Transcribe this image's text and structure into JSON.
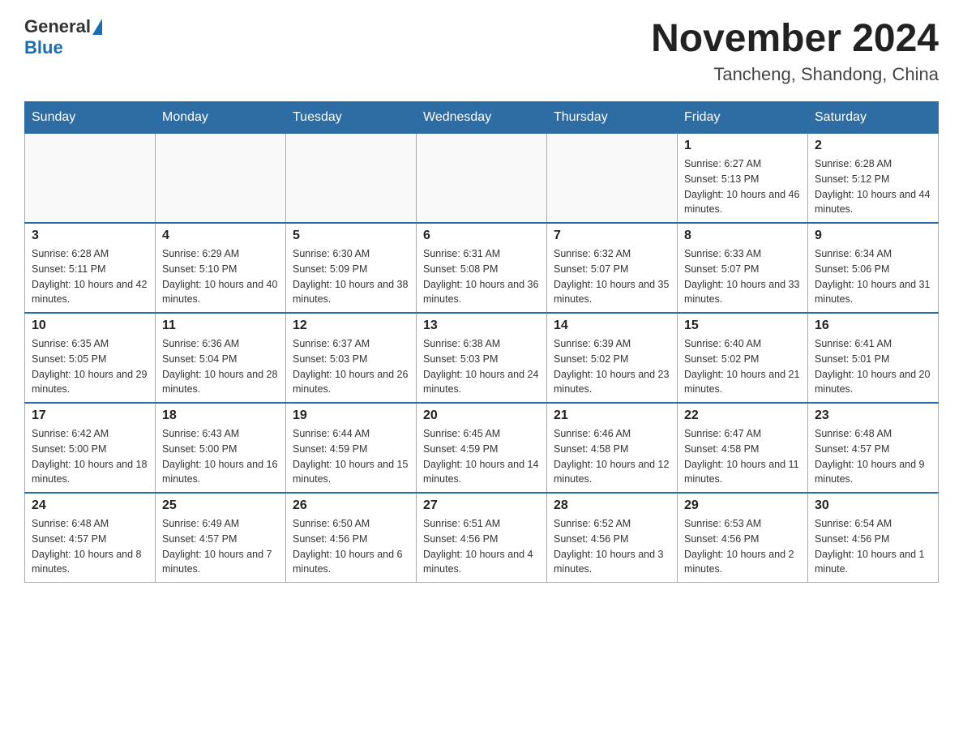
{
  "header": {
    "logo_general": "General",
    "logo_blue": "Blue",
    "month_title": "November 2024",
    "location": "Tancheng, Shandong, China"
  },
  "weekdays": [
    "Sunday",
    "Monday",
    "Tuesday",
    "Wednesday",
    "Thursday",
    "Friday",
    "Saturday"
  ],
  "weeks": [
    [
      {
        "day": "",
        "info": ""
      },
      {
        "day": "",
        "info": ""
      },
      {
        "day": "",
        "info": ""
      },
      {
        "day": "",
        "info": ""
      },
      {
        "day": "",
        "info": ""
      },
      {
        "day": "1",
        "info": "Sunrise: 6:27 AM\nSunset: 5:13 PM\nDaylight: 10 hours and 46 minutes."
      },
      {
        "day": "2",
        "info": "Sunrise: 6:28 AM\nSunset: 5:12 PM\nDaylight: 10 hours and 44 minutes."
      }
    ],
    [
      {
        "day": "3",
        "info": "Sunrise: 6:28 AM\nSunset: 5:11 PM\nDaylight: 10 hours and 42 minutes."
      },
      {
        "day": "4",
        "info": "Sunrise: 6:29 AM\nSunset: 5:10 PM\nDaylight: 10 hours and 40 minutes."
      },
      {
        "day": "5",
        "info": "Sunrise: 6:30 AM\nSunset: 5:09 PM\nDaylight: 10 hours and 38 minutes."
      },
      {
        "day": "6",
        "info": "Sunrise: 6:31 AM\nSunset: 5:08 PM\nDaylight: 10 hours and 36 minutes."
      },
      {
        "day": "7",
        "info": "Sunrise: 6:32 AM\nSunset: 5:07 PM\nDaylight: 10 hours and 35 minutes."
      },
      {
        "day": "8",
        "info": "Sunrise: 6:33 AM\nSunset: 5:07 PM\nDaylight: 10 hours and 33 minutes."
      },
      {
        "day": "9",
        "info": "Sunrise: 6:34 AM\nSunset: 5:06 PM\nDaylight: 10 hours and 31 minutes."
      }
    ],
    [
      {
        "day": "10",
        "info": "Sunrise: 6:35 AM\nSunset: 5:05 PM\nDaylight: 10 hours and 29 minutes."
      },
      {
        "day": "11",
        "info": "Sunrise: 6:36 AM\nSunset: 5:04 PM\nDaylight: 10 hours and 28 minutes."
      },
      {
        "day": "12",
        "info": "Sunrise: 6:37 AM\nSunset: 5:03 PM\nDaylight: 10 hours and 26 minutes."
      },
      {
        "day": "13",
        "info": "Sunrise: 6:38 AM\nSunset: 5:03 PM\nDaylight: 10 hours and 24 minutes."
      },
      {
        "day": "14",
        "info": "Sunrise: 6:39 AM\nSunset: 5:02 PM\nDaylight: 10 hours and 23 minutes."
      },
      {
        "day": "15",
        "info": "Sunrise: 6:40 AM\nSunset: 5:02 PM\nDaylight: 10 hours and 21 minutes."
      },
      {
        "day": "16",
        "info": "Sunrise: 6:41 AM\nSunset: 5:01 PM\nDaylight: 10 hours and 20 minutes."
      }
    ],
    [
      {
        "day": "17",
        "info": "Sunrise: 6:42 AM\nSunset: 5:00 PM\nDaylight: 10 hours and 18 minutes."
      },
      {
        "day": "18",
        "info": "Sunrise: 6:43 AM\nSunset: 5:00 PM\nDaylight: 10 hours and 16 minutes."
      },
      {
        "day": "19",
        "info": "Sunrise: 6:44 AM\nSunset: 4:59 PM\nDaylight: 10 hours and 15 minutes."
      },
      {
        "day": "20",
        "info": "Sunrise: 6:45 AM\nSunset: 4:59 PM\nDaylight: 10 hours and 14 minutes."
      },
      {
        "day": "21",
        "info": "Sunrise: 6:46 AM\nSunset: 4:58 PM\nDaylight: 10 hours and 12 minutes."
      },
      {
        "day": "22",
        "info": "Sunrise: 6:47 AM\nSunset: 4:58 PM\nDaylight: 10 hours and 11 minutes."
      },
      {
        "day": "23",
        "info": "Sunrise: 6:48 AM\nSunset: 4:57 PM\nDaylight: 10 hours and 9 minutes."
      }
    ],
    [
      {
        "day": "24",
        "info": "Sunrise: 6:48 AM\nSunset: 4:57 PM\nDaylight: 10 hours and 8 minutes."
      },
      {
        "day": "25",
        "info": "Sunrise: 6:49 AM\nSunset: 4:57 PM\nDaylight: 10 hours and 7 minutes."
      },
      {
        "day": "26",
        "info": "Sunrise: 6:50 AM\nSunset: 4:56 PM\nDaylight: 10 hours and 6 minutes."
      },
      {
        "day": "27",
        "info": "Sunrise: 6:51 AM\nSunset: 4:56 PM\nDaylight: 10 hours and 4 minutes."
      },
      {
        "day": "28",
        "info": "Sunrise: 6:52 AM\nSunset: 4:56 PM\nDaylight: 10 hours and 3 minutes."
      },
      {
        "day": "29",
        "info": "Sunrise: 6:53 AM\nSunset: 4:56 PM\nDaylight: 10 hours and 2 minutes."
      },
      {
        "day": "30",
        "info": "Sunrise: 6:54 AM\nSunset: 4:56 PM\nDaylight: 10 hours and 1 minute."
      }
    ]
  ]
}
